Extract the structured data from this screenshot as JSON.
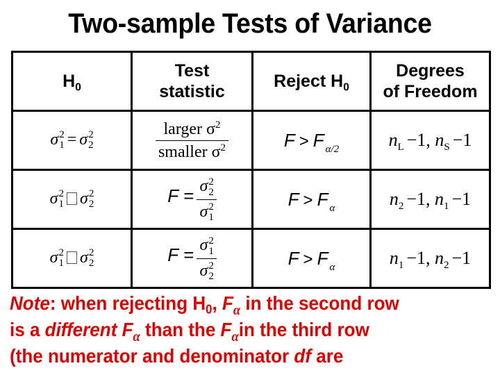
{
  "title": "Two-sample Tests of Variance",
  "table": {
    "headers": [
      {
        "main": "H",
        "sub": "0"
      },
      {
        "line1": "Test",
        "line2": "statistic"
      },
      {
        "main": "Reject H",
        "sub": "0"
      },
      {
        "line1": "Degrees",
        "line2": "of Freedom"
      }
    ],
    "rows": [
      {
        "h0": {
          "left_sub": "1",
          "sup": "2",
          "op": "=",
          "right_sub": "2"
        },
        "statistic": {
          "numerator": "larger σ",
          "denominator": "smaller σ",
          "sup": "2"
        },
        "reject": {
          "lhs": "F",
          "op": ">",
          "rhs": "F",
          "rhs_sub": "α/2"
        },
        "df": {
          "a_sub": "L",
          "b_sub": "S",
          "minus": "−1,",
          "minus_end": "−1"
        }
      },
      {
        "h0": {
          "left_sub": "1",
          "sup": "2",
          "op": "unrendered-symbol",
          "right_sub": "2"
        },
        "statistic": {
          "lhs": "F =",
          "num_sub": "2",
          "den_sub": "1",
          "sup": "2"
        },
        "reject": {
          "lhs": "F",
          "op": ">",
          "rhs": "F",
          "rhs_sub": "α"
        },
        "df": {
          "a_sub": "2",
          "b_sub": "1",
          "minus": "−1,",
          "minus_end": "−1"
        }
      },
      {
        "h0": {
          "left_sub": "1",
          "sup": "2",
          "op": "unrendered-symbol",
          "right_sub": "2"
        },
        "statistic": {
          "lhs": "F =",
          "num_sub": "1",
          "den_sub": "2",
          "sup": "2"
        },
        "reject": {
          "lhs": "F",
          "op": ">",
          "rhs": "F",
          "rhs_sub": "α"
        },
        "df": {
          "a_sub": "1",
          "b_sub": "2",
          "minus": "−1,",
          "minus_end": "−1"
        }
      }
    ],
    "sigma": "σ",
    "n": "n"
  },
  "note": {
    "line1": {
      "note_word": "Note",
      "t1": ": when rejecting H",
      "h_sub": "0",
      "t2": ", ",
      "F": "F",
      "alpha": "α",
      "t3": " in the second row"
    },
    "line2": {
      "t1": "is a ",
      "different": "different",
      "F": "F",
      "alpha": "α",
      "t2": " than the ",
      "t3": "in the third row"
    },
    "line3": {
      "t1": "(the numerator and denominator ",
      "df": "df",
      "t2": " are"
    }
  },
  "colors": {
    "note": "#e00000",
    "border": "#000000"
  }
}
